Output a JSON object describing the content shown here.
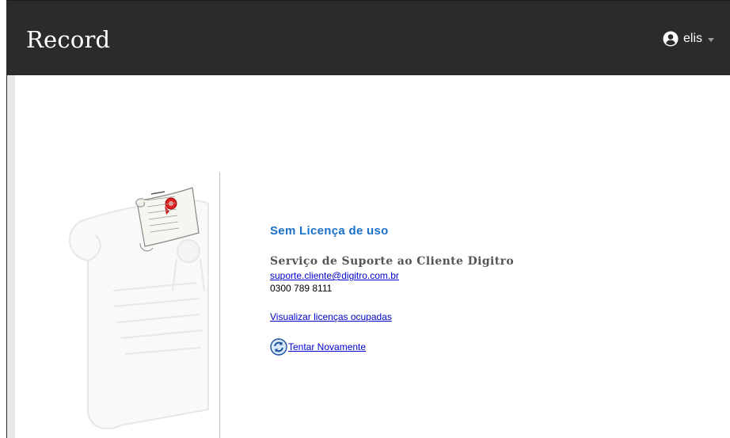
{
  "navbar": {
    "brand": "Record",
    "user": {
      "name": "elis",
      "icon": "user-circle-icon"
    }
  },
  "license_panel": {
    "illustration": "license-scroll-icon",
    "title": "Sem Licença de uso",
    "support_title": "Serviço de Suporte ao Cliente Digitro",
    "support_email": "suporte.cliente@digitro.com.br",
    "support_phone": "0300 789 8111",
    "view_licenses_link": "Visualizar licenças ocupadas",
    "retry_link": "Tentar Novamente",
    "retry_icon": "refresh-icon"
  },
  "colors": {
    "navbar_bg": "#2b2b2b",
    "title_blue": "#1a6fc9",
    "link_blue": "#0000cc"
  }
}
